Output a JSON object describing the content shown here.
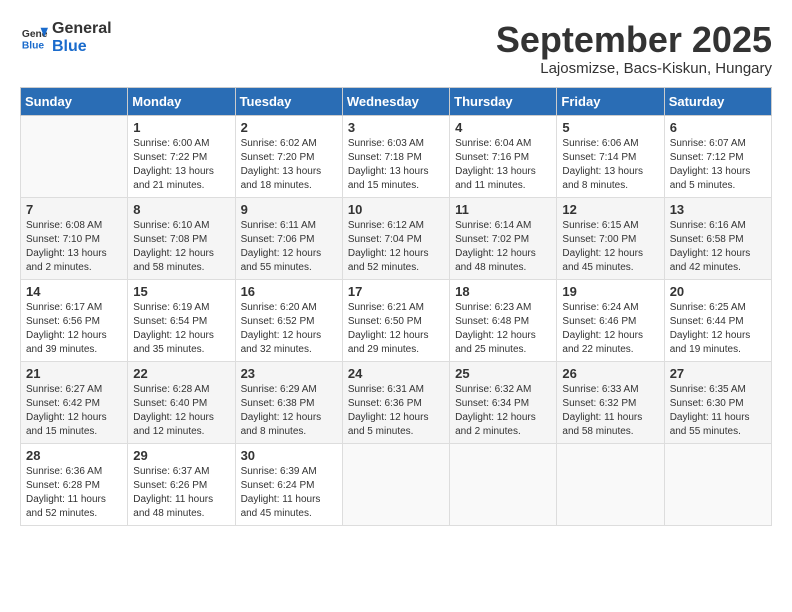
{
  "logo": {
    "general": "General",
    "blue": "Blue"
  },
  "title": "September 2025",
  "location": "Lajosmizse, Bacs-Kiskun, Hungary",
  "weekdays": [
    "Sunday",
    "Monday",
    "Tuesday",
    "Wednesday",
    "Thursday",
    "Friday",
    "Saturday"
  ],
  "weeks": [
    [
      {
        "day": "",
        "info": ""
      },
      {
        "day": "1",
        "info": "Sunrise: 6:00 AM\nSunset: 7:22 PM\nDaylight: 13 hours\nand 21 minutes."
      },
      {
        "day": "2",
        "info": "Sunrise: 6:02 AM\nSunset: 7:20 PM\nDaylight: 13 hours\nand 18 minutes."
      },
      {
        "day": "3",
        "info": "Sunrise: 6:03 AM\nSunset: 7:18 PM\nDaylight: 13 hours\nand 15 minutes."
      },
      {
        "day": "4",
        "info": "Sunrise: 6:04 AM\nSunset: 7:16 PM\nDaylight: 13 hours\nand 11 minutes."
      },
      {
        "day": "5",
        "info": "Sunrise: 6:06 AM\nSunset: 7:14 PM\nDaylight: 13 hours\nand 8 minutes."
      },
      {
        "day": "6",
        "info": "Sunrise: 6:07 AM\nSunset: 7:12 PM\nDaylight: 13 hours\nand 5 minutes."
      }
    ],
    [
      {
        "day": "7",
        "info": "Sunrise: 6:08 AM\nSunset: 7:10 PM\nDaylight: 13 hours\nand 2 minutes."
      },
      {
        "day": "8",
        "info": "Sunrise: 6:10 AM\nSunset: 7:08 PM\nDaylight: 12 hours\nand 58 minutes."
      },
      {
        "day": "9",
        "info": "Sunrise: 6:11 AM\nSunset: 7:06 PM\nDaylight: 12 hours\nand 55 minutes."
      },
      {
        "day": "10",
        "info": "Sunrise: 6:12 AM\nSunset: 7:04 PM\nDaylight: 12 hours\nand 52 minutes."
      },
      {
        "day": "11",
        "info": "Sunrise: 6:14 AM\nSunset: 7:02 PM\nDaylight: 12 hours\nand 48 minutes."
      },
      {
        "day": "12",
        "info": "Sunrise: 6:15 AM\nSunset: 7:00 PM\nDaylight: 12 hours\nand 45 minutes."
      },
      {
        "day": "13",
        "info": "Sunrise: 6:16 AM\nSunset: 6:58 PM\nDaylight: 12 hours\nand 42 minutes."
      }
    ],
    [
      {
        "day": "14",
        "info": "Sunrise: 6:17 AM\nSunset: 6:56 PM\nDaylight: 12 hours\nand 39 minutes."
      },
      {
        "day": "15",
        "info": "Sunrise: 6:19 AM\nSunset: 6:54 PM\nDaylight: 12 hours\nand 35 minutes."
      },
      {
        "day": "16",
        "info": "Sunrise: 6:20 AM\nSunset: 6:52 PM\nDaylight: 12 hours\nand 32 minutes."
      },
      {
        "day": "17",
        "info": "Sunrise: 6:21 AM\nSunset: 6:50 PM\nDaylight: 12 hours\nand 29 minutes."
      },
      {
        "day": "18",
        "info": "Sunrise: 6:23 AM\nSunset: 6:48 PM\nDaylight: 12 hours\nand 25 minutes."
      },
      {
        "day": "19",
        "info": "Sunrise: 6:24 AM\nSunset: 6:46 PM\nDaylight: 12 hours\nand 22 minutes."
      },
      {
        "day": "20",
        "info": "Sunrise: 6:25 AM\nSunset: 6:44 PM\nDaylight: 12 hours\nand 19 minutes."
      }
    ],
    [
      {
        "day": "21",
        "info": "Sunrise: 6:27 AM\nSunset: 6:42 PM\nDaylight: 12 hours\nand 15 minutes."
      },
      {
        "day": "22",
        "info": "Sunrise: 6:28 AM\nSunset: 6:40 PM\nDaylight: 12 hours\nand 12 minutes."
      },
      {
        "day": "23",
        "info": "Sunrise: 6:29 AM\nSunset: 6:38 PM\nDaylight: 12 hours\nand 8 minutes."
      },
      {
        "day": "24",
        "info": "Sunrise: 6:31 AM\nSunset: 6:36 PM\nDaylight: 12 hours\nand 5 minutes."
      },
      {
        "day": "25",
        "info": "Sunrise: 6:32 AM\nSunset: 6:34 PM\nDaylight: 12 hours\nand 2 minutes."
      },
      {
        "day": "26",
        "info": "Sunrise: 6:33 AM\nSunset: 6:32 PM\nDaylight: 11 hours\nand 58 minutes."
      },
      {
        "day": "27",
        "info": "Sunrise: 6:35 AM\nSunset: 6:30 PM\nDaylight: 11 hours\nand 55 minutes."
      }
    ],
    [
      {
        "day": "28",
        "info": "Sunrise: 6:36 AM\nSunset: 6:28 PM\nDaylight: 11 hours\nand 52 minutes."
      },
      {
        "day": "29",
        "info": "Sunrise: 6:37 AM\nSunset: 6:26 PM\nDaylight: 11 hours\nand 48 minutes."
      },
      {
        "day": "30",
        "info": "Sunrise: 6:39 AM\nSunset: 6:24 PM\nDaylight: 11 hours\nand 45 minutes."
      },
      {
        "day": "",
        "info": ""
      },
      {
        "day": "",
        "info": ""
      },
      {
        "day": "",
        "info": ""
      },
      {
        "day": "",
        "info": ""
      }
    ]
  ]
}
